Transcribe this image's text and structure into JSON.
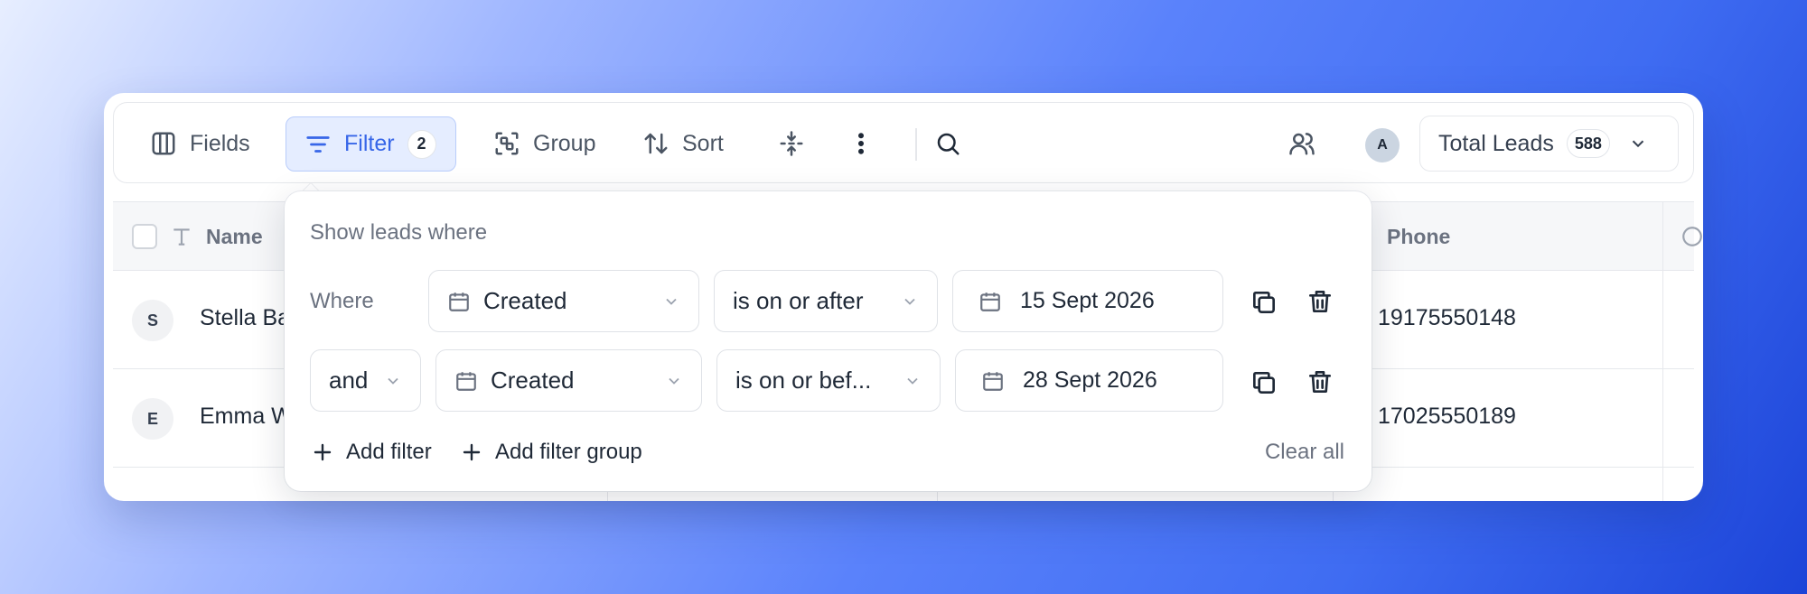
{
  "toolbar": {
    "fields_label": "Fields",
    "filter_label": "Filter",
    "filter_count": "2",
    "group_label": "Group",
    "sort_label": "Sort",
    "avatar_initial": "A",
    "total_leads_label": "Total Leads",
    "total_leads_count": "588"
  },
  "table": {
    "columns": [
      "Name",
      "Phone"
    ],
    "rows": [
      {
        "initial": "S",
        "name": "Stella Ba",
        "phone": "19175550148"
      },
      {
        "initial": "E",
        "name": "Emma W",
        "phone": "17025550189"
      }
    ]
  },
  "filter_popup": {
    "title": "Show leads where",
    "rows": [
      {
        "conjunction": "Where",
        "field": "Created",
        "operator": "is on or after",
        "value": "15 Sept 2026"
      },
      {
        "conjunction": "and",
        "field": "Created",
        "operator": "is on or bef...",
        "value": "28 Sept 2026"
      }
    ],
    "add_filter_label": "Add filter",
    "add_filter_group_label": "Add filter group",
    "clear_all_label": "Clear all"
  },
  "colors": {
    "accent": "#3766e8",
    "accent_bg": "#e5edff"
  }
}
